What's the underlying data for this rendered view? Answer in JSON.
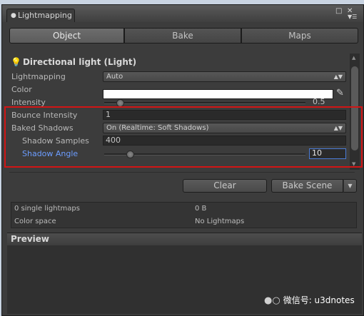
{
  "window": {
    "tab_title": "Lightmapping",
    "tab_icon": "lightbulb-icon",
    "controls": {
      "maximize_icon": "maximize-icon",
      "close_icon": "close-icon",
      "menu_icon": "context-menu-icon"
    }
  },
  "tabs": [
    {
      "label": "Object",
      "active": true
    },
    {
      "label": "Bake",
      "active": false
    },
    {
      "label": "Maps",
      "active": false
    }
  ],
  "object": {
    "header": "Directional light (Light)",
    "header_icon": "lightbulb-icon",
    "fields": {
      "lightmapping": {
        "label": "Lightmapping",
        "value": "Auto"
      },
      "color": {
        "label": "Color",
        "value": "#ffffff"
      },
      "intensity": {
        "label": "Intensity",
        "value": "0.5",
        "fraction": 0.06
      },
      "bounce_intensity": {
        "label": "Bounce Intensity",
        "value": "1"
      },
      "baked_shadows": {
        "label": "Baked Shadows",
        "value": "On (Realtime: Soft Shadows)"
      },
      "shadow_samples": {
        "label": "Shadow Samples",
        "value": "400"
      },
      "shadow_angle": {
        "label": "Shadow Angle",
        "value": "10",
        "fraction": 0.11
      }
    }
  },
  "buttons": {
    "clear": "Clear",
    "bake_scene": "Bake Scene"
  },
  "info": {
    "lightmaps": "0 single lightmaps",
    "size": "0 B",
    "color_space_label": "Color space",
    "color_space_value": "No Lightmaps"
  },
  "preview": {
    "title": "Preview"
  },
  "watermark": {
    "text": "微信号: u3dnotes"
  },
  "colors": {
    "highlight": "#d21515",
    "focused_label": "#6c9dff"
  }
}
